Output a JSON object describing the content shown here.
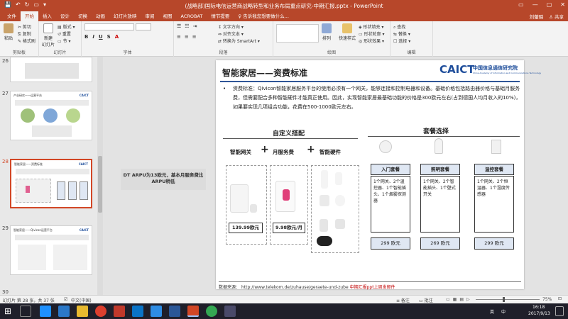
{
  "titlebar": {
    "title": "(战略部)国际电信运营商战略转型和业务布局重点研究-中期汇报.pptx - PowerPoint",
    "quick_access": [
      "💾",
      "↶",
      "↻",
      "▭",
      "▾"
    ],
    "window_controls": [
      "▭",
      "—",
      "▢",
      "✕"
    ]
  },
  "tabs": [
    {
      "label": "文件"
    },
    {
      "label": "开始"
    },
    {
      "label": "插入"
    },
    {
      "label": "设计"
    },
    {
      "label": "切换"
    },
    {
      "label": "动画"
    },
    {
      "label": "幻灯片放映"
    },
    {
      "label": "审阅"
    },
    {
      "label": "视图"
    },
    {
      "label": "ACROBAT"
    },
    {
      "label": "情节提要"
    },
    {
      "label": "♀ 告诉我您想要做什么..."
    }
  ],
  "tabs_right": {
    "user": "刘蕾璐",
    "share": "♙ 共享"
  },
  "ribbon": {
    "groups": {
      "clipboard": "剪贴板",
      "slides": "幻灯片",
      "font": "字体",
      "paragraph": "段落",
      "drawing": "绘图",
      "editing": "编辑"
    },
    "paste": "粘贴",
    "cut": "✂ 剪切",
    "copy": "⎘ 复制",
    "format_painter": "✎ 格式刷",
    "new_slide": "新建\n幻灯片",
    "layout": "▤ 版式 ▾",
    "reset": "↺ 重置",
    "section": "▭ 节 ▾",
    "font_name": "",
    "font_size": "",
    "text_direction": "↕ 文字方向 ▾",
    "align_text": "⇔ 对齐文本 ▾",
    "smartart": "⇄ 转换为 SmartArt ▾",
    "arrange": "排列",
    "quick_styles": "快速样式",
    "shape_fill": "◈ 形状填充 ▾",
    "shape_outline": "▭ 形状轮廓 ▾",
    "shape_effects": "◎ 形状效果 ▾",
    "find": "⌕ 查找",
    "replace": "⇆ 替换 ▾",
    "select": "☐ 选择 ▾"
  },
  "thumbnails": [
    {
      "num": "27",
      "title": "产业研究——运营平台",
      "logo": "CAICT"
    },
    {
      "num": "28",
      "title": "智能家居——资费标准",
      "logo": "CAICT"
    },
    {
      "num": "29",
      "title": "智能家居——Qivicon运营平台",
      "logo": "CAICT"
    },
    {
      "num": "30",
      "title": "",
      "logo": ""
    }
  ],
  "note": "DT ARPU为13欧元，基本月服务费比ARPU稍低",
  "slide": {
    "title": "智能家居——资费标准",
    "logo": {
      "mark": "CAICT",
      "cn": "中国信息通信研究院",
      "en": "China Academy of Information and Communications Technology"
    },
    "bullet": "资费标准：Qivicon智能家居服务平台的使用必须有一个网关，能够连接和控制电器和设备。基础价格包括路由器价格与基础月服务费，但需要配合多种智能硬件才能真正使用。因此，实现智能家居最基础功能的价格是300欧元左右(占到德国人均月收入的10%)，如果要实现几项组合功能，花费在500-1000欧元左右。",
    "custom": {
      "heading": "自定义搭配",
      "items": [
        "智能网关",
        "月服务费",
        "智能硬件"
      ],
      "plus": "+",
      "prices": [
        "139.99欧元",
        "9.98欧元/月"
      ]
    },
    "packages": {
      "heading": "套餐选择",
      "list": [
        {
          "name": "入门套餐",
          "desc": "1个网关、2个温控器、1个智能插头、1个烟雾探测器",
          "price": "299 欧元"
        },
        {
          "name": "照明套餐",
          "desc": "1个网关、2个智能插头、1个壁式开关",
          "price": "269 欧元"
        },
        {
          "name": "温控套餐",
          "desc": "1个网关、2个恒温器、1个湿度传感器",
          "price": "299 欧元"
        }
      ]
    },
    "source_label": "数据来源：",
    "source_url": "http://www.telekom.de/zuhause/geraete-und-zube",
    "source_tail": "中期汇报ppt上周发邮件"
  },
  "statusbar": {
    "slide_info": "幻灯片 第 28 张，共 37 张",
    "lang": "中文(中国)",
    "notes": "≡ 备注",
    "comments": "▭ 批注",
    "zoom": "75%"
  },
  "taskbar": {
    "time": "16:18",
    "date": "2017/9/13",
    "ime": "英",
    "ime_label": "中"
  },
  "colors": {
    "accent": "#b7472a",
    "slide_blue": "#1f4e9b",
    "selection": "#d24726"
  }
}
